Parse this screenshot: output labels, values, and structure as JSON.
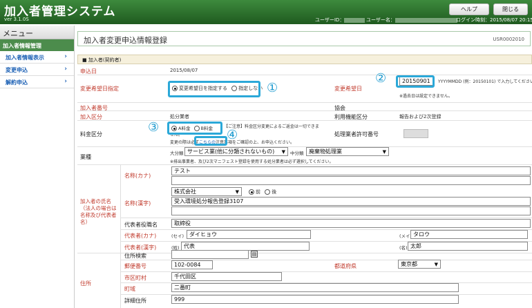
{
  "header": {
    "app_title": "加入者管理システム",
    "version": "ver  3.1.0S",
    "help_label": "ヘルプ",
    "close_label": "閉じる",
    "user_id_label": "ユーザーID：",
    "user_name_label": "ユーザー名：",
    "login_time": "ログイン時刻：2015/08/07 20:15"
  },
  "sidebar": {
    "menu_title": "メニュー",
    "group_label": "加入者情報管理",
    "items": [
      {
        "label": "加入者情報表示",
        "icon": "chevron-right-icon"
      },
      {
        "label": "変更申込",
        "icon": "chevron-right-icon"
      },
      {
        "label": "解約申込",
        "icon": "chevron-right-icon"
      }
    ]
  },
  "page": {
    "title": "加入者変更申込情報登録",
    "page_id": "USR0002010",
    "section_title": "加入者(契約者)"
  },
  "form": {
    "application_date_label": "申込日",
    "application_date_value": "2015/08/07",
    "change_date_spec_label": "変更希望日指定",
    "radio_specify": "変更希望日を指定する",
    "radio_no_specify": "指定しない",
    "change_date_label": "変更希望日",
    "change_date_value": "20150901",
    "change_date_hint": "YYYYMMDD (例：20150101) で入力してください。",
    "change_date_note": "※過去日は設定できません。",
    "member_no_label": "加入者番号",
    "association_label": "協会",
    "member_type_label": "加入区分",
    "member_type_value": "処分業者",
    "usage_label": "利用機能区分",
    "usage_value": "報告および2次登録",
    "fee_label": "料金区分",
    "fee_a": "A料金",
    "fee_b": "B料金",
    "fee_note_line1": "【ご注意】料金区分変更によるご返金は一切できま",
    "fee_note_line2": "せん。",
    "fee_note_line3a": "変更の際は必ず",
    "fee_note_link": "こちらの",
    "fee_note_line3b": "注意事項をご確認の上、お申込ください。",
    "permit_label": "処理業者許可番号",
    "industry_label": "業種",
    "major_label": "大分類",
    "major_value": "サービス業(他に分類されないもの)",
    "middle_label": "中分類",
    "middle_value": "廃棄物処理業",
    "industry_note": "※排出事業者、及び2次マニフェスト登録を使用する処分業者は必ず選択してください。",
    "name_group_label": "加入者の氏名（法人の場合は名称及び代表者名）",
    "kana_label": "名称(カナ)",
    "kana_value": "テスト",
    "kanji_label": "名称(漢字)",
    "corp_type_value": "株式会社",
    "radio_before": "前",
    "radio_after": "後",
    "kanji_value": "受入環境処分報告登録3107",
    "rep_title_label": "代表者役職名",
    "rep_title_value": "取締役",
    "rep_kana_label": "代表者(カナ)",
    "rep_sei_kana_prefix": "(セイ)",
    "rep_sei_kana_value": "ダイヒョウ",
    "rep_mei_kana_prefix": "(メイ)",
    "rep_mei_kana_value": "タロウ",
    "rep_kanji_label": "代表者(漢字)",
    "rep_sei_prefix": "(姓)",
    "rep_sei_value": "代表",
    "rep_mei_prefix": "(名)",
    "rep_mei_value": "太郎",
    "address_group_label": "住所",
    "addr_search_label": "住所検索",
    "postal_label": "郵便番号",
    "postal_value": "102-0084",
    "pref_label": "都道府県",
    "pref_value": "東京都",
    "city_label": "市区町村",
    "city_value": "千代田区",
    "town_label": "町域",
    "town_value": "二番町",
    "detail_label": "詳細住所",
    "detail_value": "999"
  },
  "annotations": {
    "c1": "①",
    "c2": "②",
    "c3": "③",
    "c4": "④",
    "accent": "#2ba8d8"
  }
}
